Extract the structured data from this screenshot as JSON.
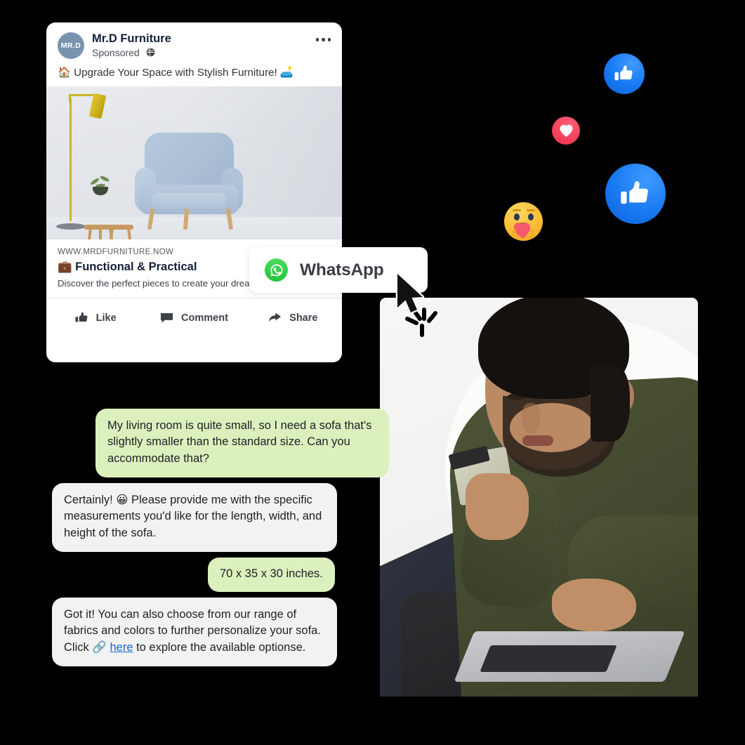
{
  "ad": {
    "avatar_text": "MR.D",
    "page_name": "Mr.D Furniture",
    "sponsored_label": "Sponsored",
    "globe_icon": "globe-icon",
    "menu_icon": "more-options-icon",
    "caption": "🏠 Upgrade Your Space with Stylish Furniture! 🛋️",
    "image_alt": "blue armchair with floor lamp and side tables",
    "url": "WWW.MRDFURNITURE.NOW",
    "link_title": "💼 Functional & Practical",
    "link_description": "Discover the perfect pieces to create your dream living space. ✨",
    "actions": [
      {
        "label": "Like",
        "icon": "thumbs-up-icon"
      },
      {
        "label": "Comment",
        "icon": "comment-icon"
      },
      {
        "label": "Share",
        "icon": "share-icon"
      }
    ],
    "avatar_color": "#7992b0"
  },
  "whatsapp": {
    "label": "WhatsApp",
    "icon": "whatsapp-icon",
    "brand_color": "#25c33c"
  },
  "cursor": {
    "icon": "mouse-cursor-icon",
    "click_burst": "click-burst-icon"
  },
  "chat": {
    "messages": [
      {
        "side": "outgoing",
        "text": "My living room is quite small, so I need a sofa that's slightly smaller than the standard size. Can you accommodate that?"
      },
      {
        "side": "incoming",
        "text": "Certainly! 😀 Please provide me with the specific measurements you'd like for the length, width, and height of the sofa."
      },
      {
        "side": "outgoing",
        "text": "70 x 35 x 30 inches."
      }
    ],
    "last_message": {
      "side": "incoming",
      "part1": "Got it! You can also choose from our range of fabrics and colors to further personalize your sofa. Click 🔗 ",
      "link": "here",
      "part2": " to explore the available optionse."
    },
    "outgoing_color": "#dcf0be",
    "incoming_color": "#f2f2f2",
    "link_color": "#1a66d0"
  },
  "reactions": [
    {
      "name": "like",
      "icon": "thumbs-up-icon",
      "color": "#1878f2",
      "size": "small"
    },
    {
      "name": "love",
      "icon": "heart-icon",
      "color": "#f23b57",
      "size": "small"
    },
    {
      "name": "like",
      "icon": "thumbs-up-icon",
      "color": "#1878f2",
      "size": "large"
    },
    {
      "name": "care",
      "icon": "care-hug-icon",
      "color": "#f7b52c",
      "size": "small"
    }
  ],
  "photo": {
    "alt": "man in olive sweatshirt holding cash and typing on laptop",
    "background_color": "#f3f3f1"
  }
}
